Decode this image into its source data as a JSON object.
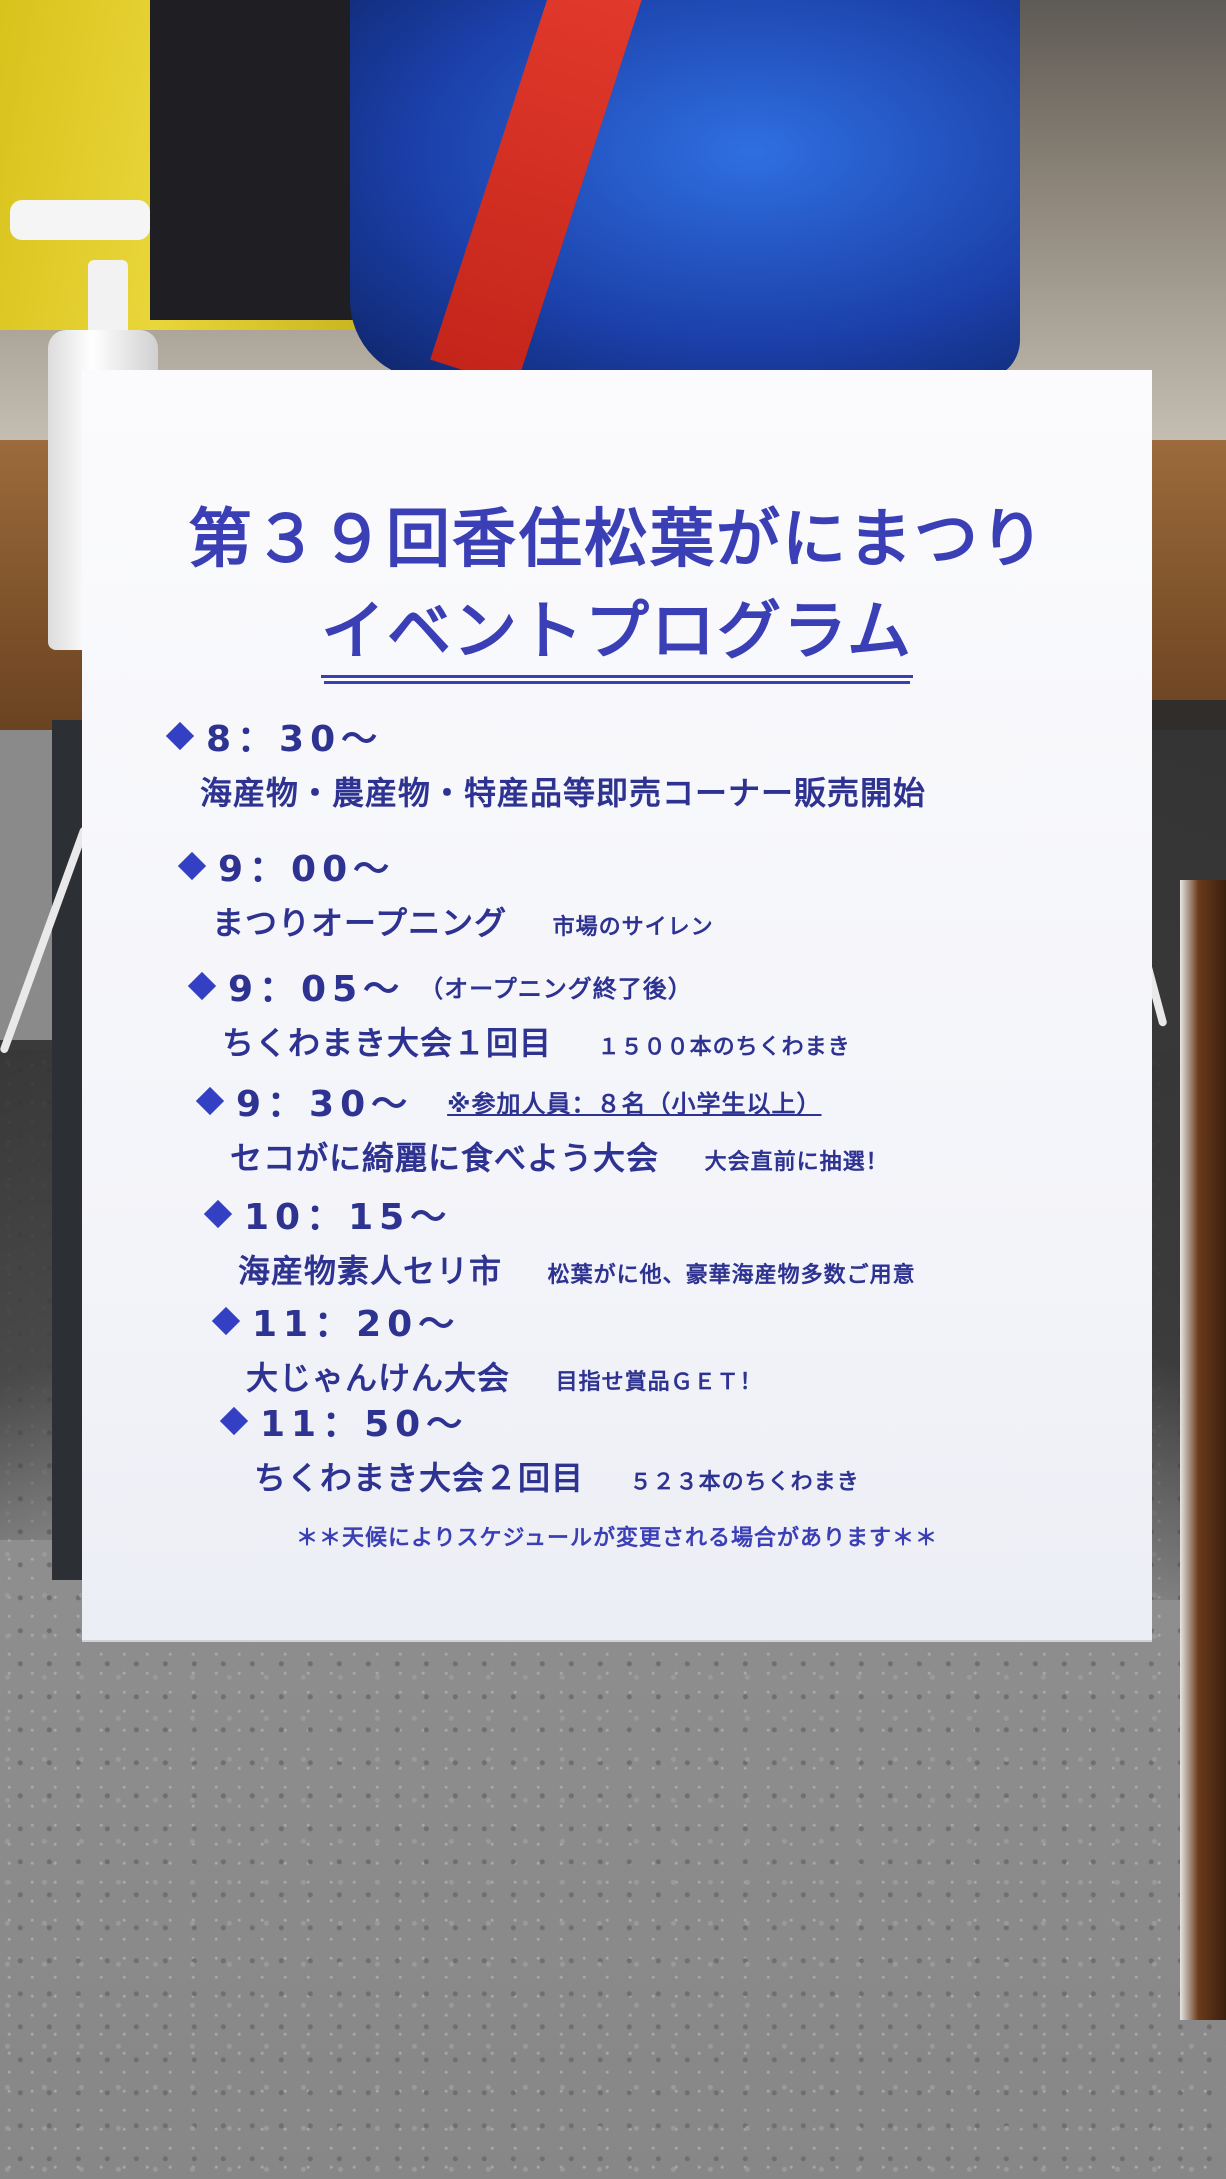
{
  "poster": {
    "title_line1": "第３９回香住松葉がにまつり",
    "title_line2": "イベントプログラム",
    "schedule": [
      {
        "time": "8：30～",
        "time_note": "",
        "description": "海産物・農産物・特産品等即売コーナー販売開始",
        "note": ""
      },
      {
        "time": "9：00～",
        "time_note": "",
        "description": "まつりオープニング",
        "note": "市場のサイレン"
      },
      {
        "time": "9：05～",
        "time_note": "（オープニング終了後）",
        "description": "ちくわまき大会１回目",
        "note": "１５００本のちくわまき"
      },
      {
        "time": "9：30～",
        "time_note": "※参加人員：８名（小学生以上）",
        "description": "セコがに綺麗に食べよう大会",
        "note": "大会直前に抽選！"
      },
      {
        "time": "10：15～",
        "time_note": "",
        "description": "海産物素人セリ市",
        "note": "松葉がに他、豪華海産物多数ご用意"
      },
      {
        "time": "11：20～",
        "time_note": "",
        "description": "大じゃんけん大会",
        "note": "目指せ賞品ＧＥＴ！"
      },
      {
        "time": "11：50～",
        "time_note": "",
        "description": "ちくわまき大会２回目",
        "note": "５２３本のちくわまき"
      }
    ],
    "footer": "＊＊天候によりスケジュールが変更される場合があります＊＊"
  },
  "colors": {
    "text": "#2e3392",
    "title": "#3b3fb6",
    "diamond": "#3340c4",
    "poster_bg": "#f7f7fb"
  },
  "icons": [
    "diamond-bullet-icon",
    "hand-sanitizer-bottle"
  ]
}
